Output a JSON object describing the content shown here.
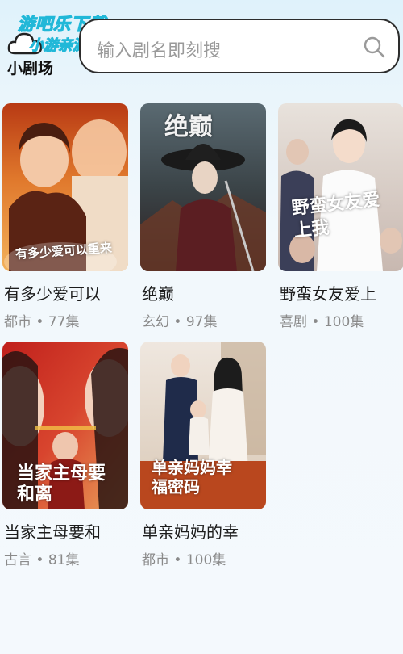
{
  "header": {
    "watermark_line1": "游吧乐下载",
    "watermark_line2": "小游亲测",
    "app_name": "小剧场",
    "search_placeholder": "输入剧名即刻搜"
  },
  "dramas": [
    {
      "title": "有多少爱可以",
      "genre": "都市",
      "episodes": "77集",
      "meta": "都市 • 77集",
      "poster_text": "有多少爱可以重来"
    },
    {
      "title": "绝巅",
      "genre": "玄幻",
      "episodes": "97集",
      "meta": "玄幻 • 97集",
      "poster_text": "绝巅"
    },
    {
      "title": "野蛮女友爱上",
      "genre": "喜剧",
      "episodes": "100集",
      "meta": "喜剧 • 100集",
      "poster_text": "野蛮女友爱上我"
    },
    {
      "title": "当家主母要和",
      "genre": "古言",
      "episodes": "81集",
      "meta": "古言 • 81集",
      "poster_text": "当家主母要和离"
    },
    {
      "title": "单亲妈妈的幸",
      "genre": "都市",
      "episodes": "100集",
      "meta": "都市 • 100集",
      "poster_text": "单亲妈妈幸福密码"
    }
  ],
  "colors": {
    "accent_watermark": "#21b8d8",
    "title_text": "#1c1c1c",
    "meta_text": "#8a8a8a"
  },
  "icons": {
    "search": "search-icon",
    "logo": "cloud-icon"
  }
}
